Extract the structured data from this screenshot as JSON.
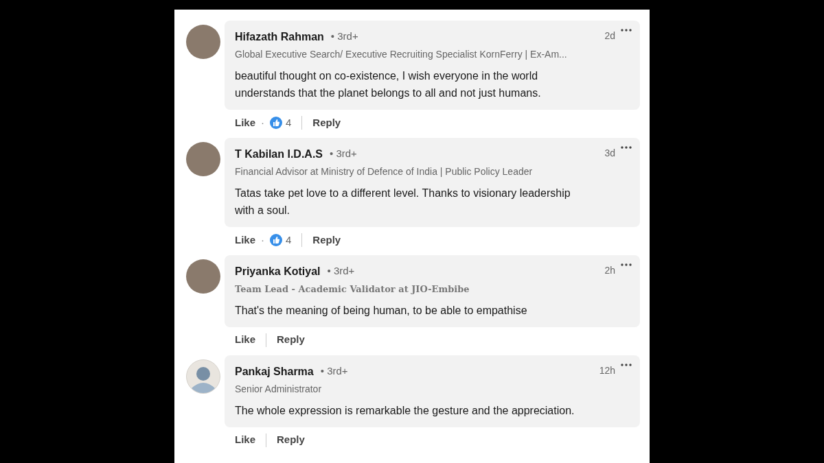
{
  "comments": [
    {
      "name": "Hifazath Rahman",
      "degree": "• 3rd+",
      "avatar": {
        "kind": "photo"
      },
      "headline": {
        "kind": "plain",
        "text": "Global Executive Search/ Executive Recruiting Specialist KornFerry | Ex-Am..."
      },
      "time": "2d",
      "text": "beautiful thought on co-existence, I wish everyone in the world understands that the planet belongs to all and not just humans.",
      "like": "Like",
      "separator": "·",
      "reaction_count": "4",
      "reply": "Reply"
    },
    {
      "name": "T Kabilan I.D.A.S",
      "degree": "• 3rd+",
      "avatar": {
        "kind": "photo"
      },
      "headline": {
        "kind": "plain",
        "text": "Financial Advisor at Ministry of Defence of India | Public Policy Leader"
      },
      "time": "3d",
      "text": "Tatas take pet love to a different level. Thanks to visionary leadership with a soul.",
      "like": "Like",
      "separator": "·",
      "reaction_count": "4",
      "reply": "Reply"
    },
    {
      "name": "Priyanka Kotiyal",
      "degree": "• 3rd+",
      "avatar": {
        "kind": "photo"
      },
      "headline": {
        "kind": "serif",
        "text": "Team Lead - Academic Validator at JIO-Embibe"
      },
      "time": "2h",
      "text": "That's the meaning of being human, to be able to empathise",
      "like": "Like",
      "reply": "Reply"
    },
    {
      "name": "Pankaj Sharma",
      "degree": "• 3rd+",
      "avatar": {
        "kind": "default"
      },
      "headline": {
        "kind": "plain",
        "text": "Senior Administrator"
      },
      "time": "12h",
      "text": "The whole expression is remarkable the gesture and the appreciation.",
      "like": "Like",
      "reply": "Reply"
    }
  ]
}
